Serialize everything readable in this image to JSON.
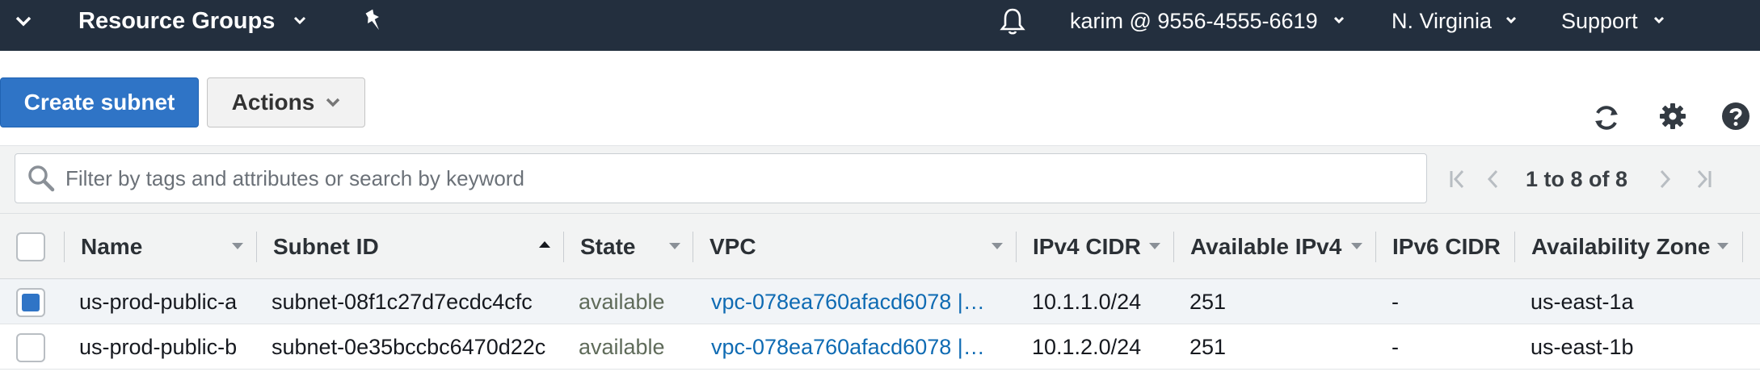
{
  "nav": {
    "resource_groups": "Resource Groups",
    "account": "karim @ 9556-4555-6619",
    "region": "N. Virginia",
    "support": "Support"
  },
  "toolbar": {
    "create_label": "Create subnet",
    "actions_label": "Actions"
  },
  "filter": {
    "placeholder": "Filter by tags and attributes or search by keyword"
  },
  "pagination": {
    "text": "1 to 8 of 8"
  },
  "table": {
    "columns": [
      "Name",
      "Subnet ID",
      "State",
      "VPC",
      "IPv4 CIDR",
      "Available IPv4",
      "IPv6 CIDR",
      "Availability Zone"
    ],
    "sorted_column": "Subnet ID",
    "rows": [
      {
        "selected": true,
        "name": "us-prod-public-a",
        "subnet_id": "subnet-08f1c27d7ecdc4cfc",
        "state": "available",
        "vpc": "vpc-078ea760afacd6078 |…",
        "ipv4_cidr": "10.1.1.0/24",
        "available_ipv4": "251",
        "ipv6_cidr": "-",
        "availability_zone": "us-east-1a"
      },
      {
        "selected": false,
        "name": "us-prod-public-b",
        "subnet_id": "subnet-0e35bccbc6470d22c",
        "state": "available",
        "vpc": "vpc-078ea760afacd6078 |…",
        "ipv4_cidr": "10.1.2.0/24",
        "available_ipv4": "251",
        "ipv6_cidr": "-",
        "availability_zone": "us-east-1b"
      }
    ]
  },
  "icons": {
    "menu": "chevron-down-icon",
    "pin": "pin-icon",
    "notifications": "bell-icon",
    "refresh": "refresh-icon",
    "settings": "gear-icon",
    "help": "help-icon",
    "search": "search-icon"
  },
  "colors": {
    "nav_bg": "#232f3e",
    "primary": "#2f74c6",
    "link": "#0f6bb3",
    "header_bg": "#f2f3f3",
    "selected_row": "#f1f4f7"
  }
}
